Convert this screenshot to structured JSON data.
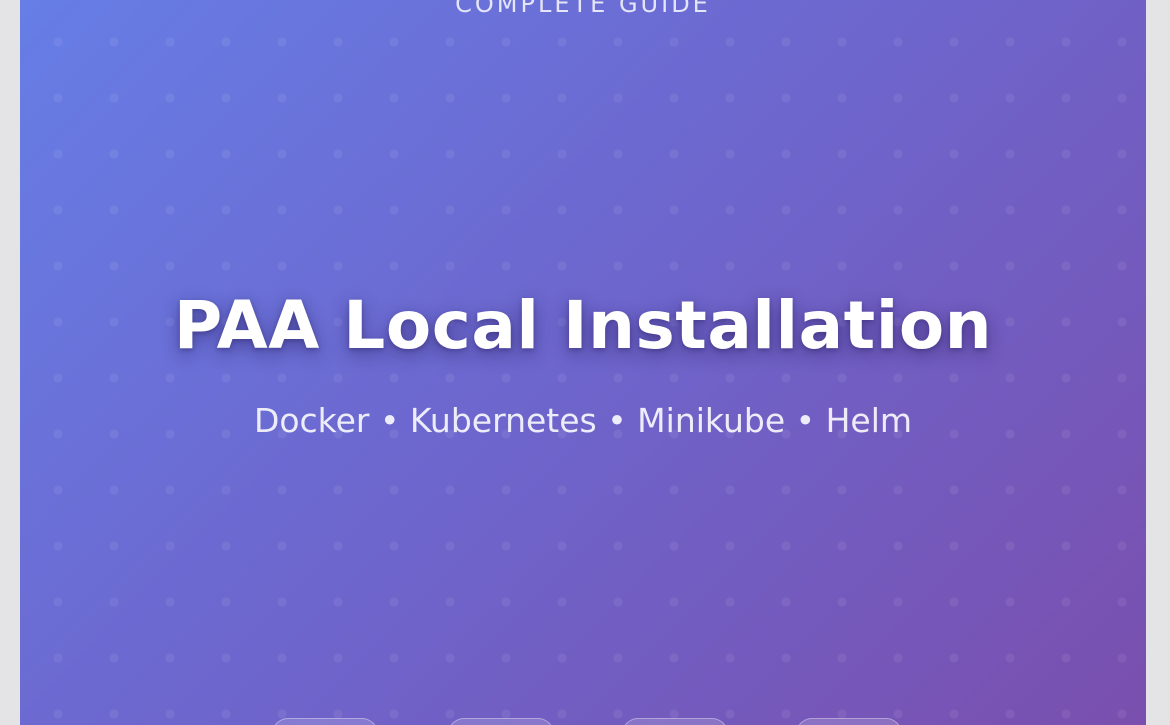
{
  "hero": {
    "eyebrow": "COMPLETE GUIDE",
    "title": "PAA Local Installation",
    "subtitle": "Docker • Kubernetes • Minikube • Helm"
  },
  "colors": {
    "gradient_start": "#667ee6",
    "gradient_end": "#7a4fae",
    "text": "#ffffff",
    "page_background": "#e4e4e6"
  }
}
